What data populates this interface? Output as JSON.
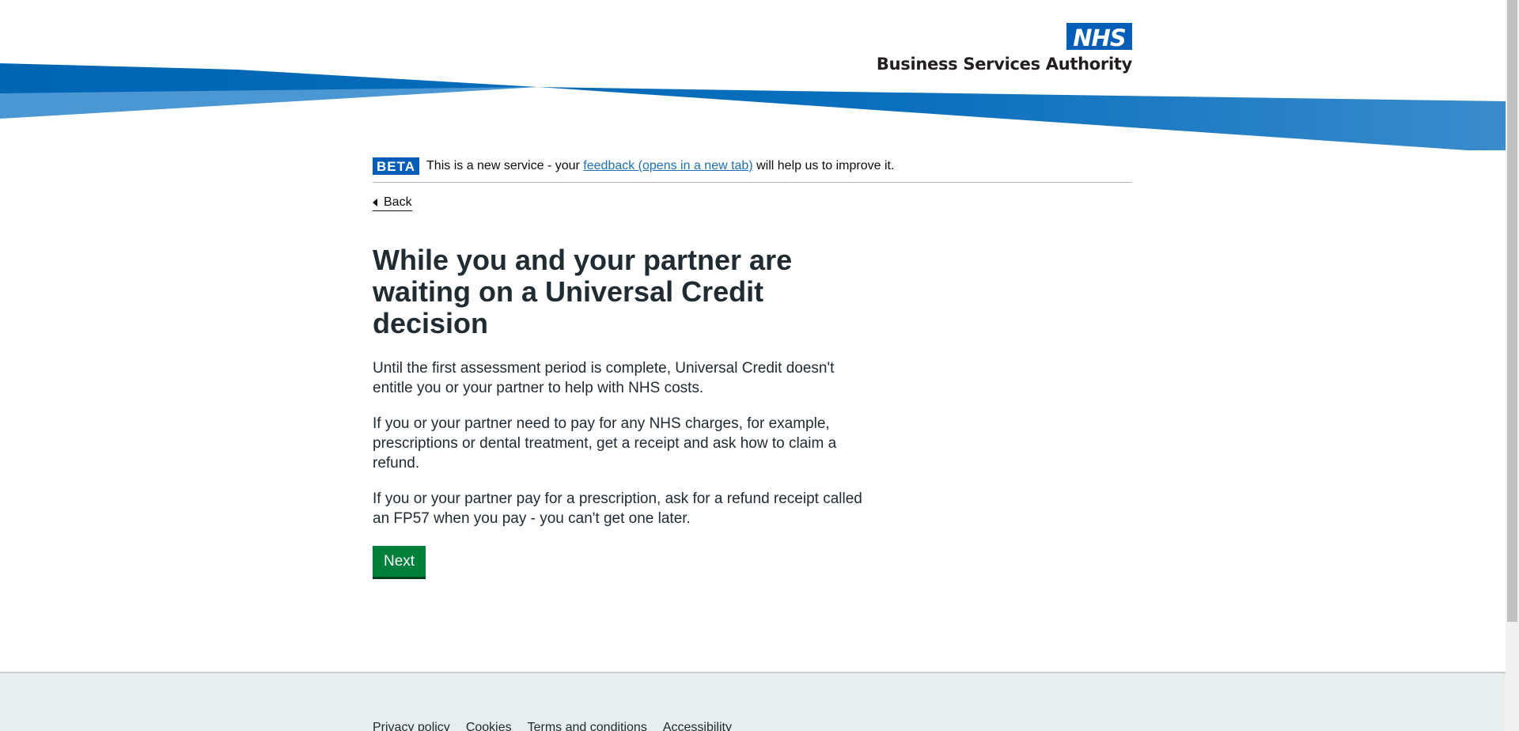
{
  "header": {
    "logo_badge": "NHS",
    "org_name": "Business Services Authority",
    "colors": {
      "brand_blue": "#005eb8",
      "wave_dark": "#0072c6",
      "wave_light": "#41a2dc"
    }
  },
  "phase_banner": {
    "tag": "BETA",
    "text_before": "This is a new service - your ",
    "link_text": "feedback (opens in a new tab)",
    "text_after": " will help us to improve it."
  },
  "back_link": {
    "label": "Back"
  },
  "main": {
    "title": "While you and your partner are waiting on a Universal Credit decision",
    "paragraphs": [
      "Until the first assessment period is complete, Universal Credit doesn't entitle you or your partner to help with NHS costs.",
      "If you or your partner need to pay for any NHS charges, for example, prescriptions or dental treatment, get a receipt and ask how to claim a refund.",
      "If you or your partner pay for a prescription, ask for a refund receipt called an FP57 when you pay - you can't get one later."
    ],
    "next_button": "Next",
    "button_color": "#007f3b"
  },
  "footer": {
    "links": [
      "Privacy policy",
      "Cookies",
      "Terms and conditions",
      "Accessibility"
    ]
  }
}
